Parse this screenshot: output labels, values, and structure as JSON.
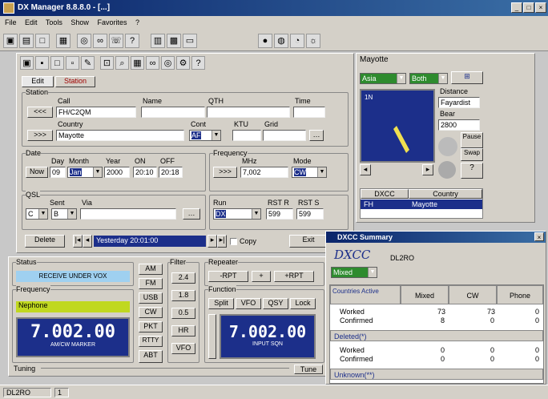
{
  "window": {
    "title": "DX Manager 8.8.8.0 - [...]",
    "minimize": "_",
    "maximize": "□",
    "close": "×"
  },
  "menu": [
    "File",
    "Edit",
    "Tools",
    "Show",
    "Favorites",
    "?"
  ],
  "toolbar": {
    "icons": [
      "save-icon",
      "open-icon",
      "new-icon",
      "print-icon",
      "radio-icon",
      "binoculars-icon",
      "phone-icon",
      "help-icon",
      "calc-icon",
      "grid-icon",
      "globe-icon",
      "rss-icon",
      "chart-icon",
      "sun-icon"
    ]
  },
  "tabs": [
    "Edit",
    "Station"
  ],
  "station": {
    "group": "Station",
    "call_label": "Call",
    "call_value": "FH/C2QM",
    "name_label": "Name",
    "qth_label": "QTH",
    "time_label": "Time",
    "country_label": "Country",
    "country_value": "Mayotte",
    "cont_label": "Cont",
    "cont_value": "AF",
    "ktu_label": "KTU",
    "grid_label": "Grid",
    "button1": "<<<",
    "button2": ">>>"
  },
  "date": {
    "group": "Date",
    "day_label": "Day",
    "month_label": "Month",
    "year_label": "Year",
    "on_label": "ON",
    "off_label": "OFF",
    "day": "09",
    "month": "Jan",
    "year": "2000",
    "on": "20:10",
    "off": "20:18",
    "button": "Now"
  },
  "freq": {
    "group": "Frequency",
    "mhz_label": "MHz",
    "mode_label": "Mode",
    "mhz": "7,002",
    "mode": "CW",
    "button": ">>>"
  },
  "qsl": {
    "group": "QSL",
    "sent_label": "Sent",
    "via_label": "Via",
    "value1": "C",
    "value2": "B"
  },
  "rst": {
    "run_label": "Run",
    "rst_r_label": "RST R",
    "rst_s_label": "RST S",
    "run_value": "DX",
    "rst_r": "599",
    "rst_s": "599"
  },
  "bottom_row": {
    "delete": "Delete",
    "record": "Yesterday 20:01:00",
    "copy_label": "Copy",
    "exit": "Exit"
  },
  "radio": {
    "status_group": "Status",
    "status_value": "RECEIVE UNDER VOX",
    "freq_group": "Frequency",
    "mode_value": "Nephone",
    "freq_display": "7.002.00",
    "freq_sub": "AM/CW MARKER",
    "mode_buttons": [
      "AM",
      "FM",
      "USB",
      "CW",
      "PKT",
      "RTTY",
      "ABT"
    ],
    "filter_group": "Filter",
    "filter_buttons": [
      "2.4",
      "1.8",
      "0.5",
      "HR",
      "VFO"
    ],
    "repeater_group": "Repeater",
    "rep_buttons": [
      "-RPT",
      "+",
      "+RPT"
    ],
    "function_group": "Function",
    "fn_buttons": [
      "Split",
      "VFO",
      "QSY",
      "Lock"
    ],
    "freq2": "7.002.00",
    "freq2_sub": "INPUT SQN",
    "tuning_label": "Tuning",
    "tune_button": "Tune"
  },
  "map": {
    "title": "Mayotte",
    "combo1": "Asia",
    "combo2": "Both",
    "coord": "1N",
    "dir_label": "Distance",
    "dir_value": "Fayardist",
    "bearing_label": "Bear",
    "bearing_value": "2800",
    "pause": "Pause",
    "swap": "Swap"
  },
  "country_list": {
    "headers": [
      "DXCC",
      "Country"
    ],
    "row": [
      "FH",
      "Mayotte"
    ]
  },
  "dxcc": {
    "title": "DXCC Summary",
    "heading": "DXCC",
    "call": "DL2RO",
    "combo": "Mixed",
    "headers": [
      "Countries Active",
      "Mixed",
      "CW",
      "Phone"
    ],
    "sections": [
      {
        "label": "",
        "rows": [
          [
            "Worked",
            "73",
            "73",
            "0"
          ],
          [
            "Confirmed",
            "8",
            "0",
            "0"
          ]
        ]
      },
      {
        "label": "Deleted(*)",
        "rows": []
      },
      {
        "label": "",
        "rows": [
          [
            "Worked",
            "0",
            "0",
            "0"
          ],
          [
            "Confirmed",
            "0",
            "0",
            "0"
          ]
        ]
      },
      {
        "label": "Unknown(**)",
        "rows": []
      }
    ]
  },
  "statusbar": {
    "call": "DL2RO",
    "value": "1"
  }
}
